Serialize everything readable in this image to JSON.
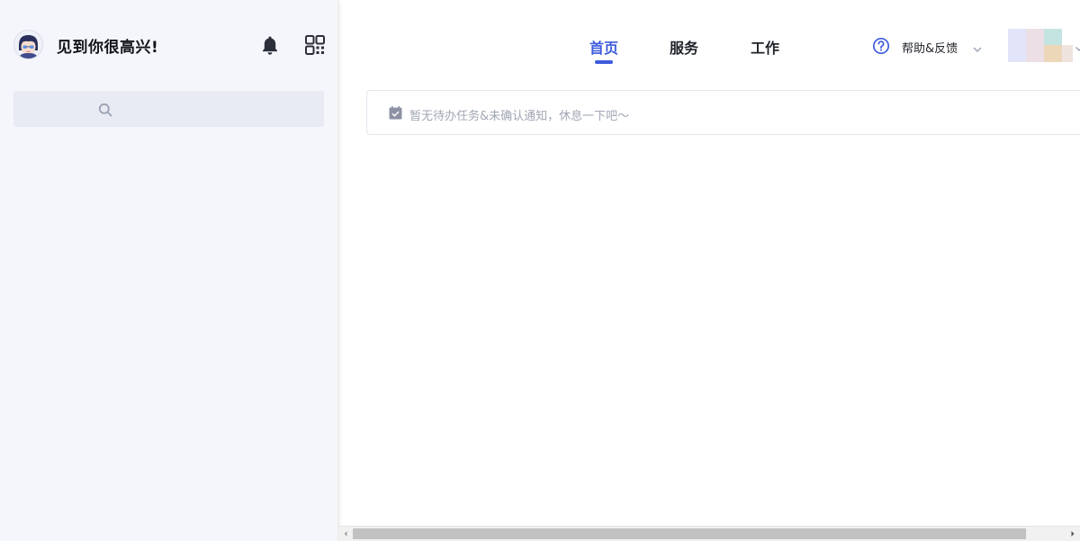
{
  "sidebar": {
    "greeting": "见到你很高兴!",
    "icons": {
      "notifications": "bell-icon",
      "qrcode": "qr-code-icon",
      "search": "search-icon"
    },
    "search": {
      "value": "",
      "placeholder": ""
    }
  },
  "nav": {
    "tabs": [
      {
        "label": "首页",
        "active": true
      },
      {
        "label": "服务",
        "active": false
      },
      {
        "label": "工作",
        "active": false
      }
    ],
    "help_label": "帮助&反馈"
  },
  "notice": {
    "text": "暂无待办任务&未确认通知，休息一下吧～"
  },
  "colors": {
    "accent": "#3d5bdc",
    "sidebar_bg": "#f5f6fb",
    "search_bg": "#e8ebf4",
    "muted_text": "#a0a6b3"
  }
}
